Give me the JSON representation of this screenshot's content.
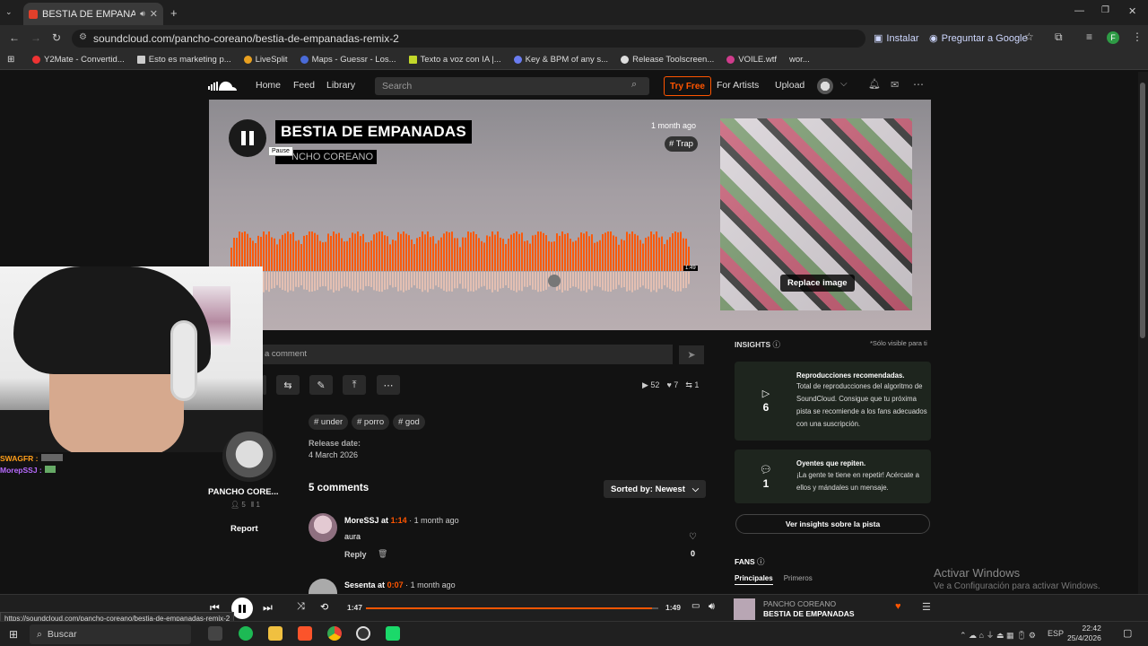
{
  "browser": {
    "tab_title": "BESTIA DE EMPANADAS by",
    "url": "soundcloud.com/pancho-coreano/bestia-de-empanadas-remix-2",
    "install_label": "Instalar",
    "ask_google_label": "Preguntar a Google",
    "bookmarks": [
      "Y2Mate - Convertid...",
      "Esto es marketing p...",
      "LiveSplit",
      "Maps - Guessr - Los...",
      "Texto a voz con IA |...",
      "Key & BPM of any s...",
      "Release Toolscreen...",
      "VOILE.wtf",
      "wor..."
    ],
    "profile_initial": "F"
  },
  "nav": {
    "home": "Home",
    "feed": "Feed",
    "library": "Library",
    "search_placeholder": "Search",
    "try_free": "Try Free",
    "for_artists": "For Artists",
    "upload": "Upload"
  },
  "track": {
    "title": "BESTIA DE EMPANADAS",
    "artist": "PANCHO COREANO",
    "artist_partial": "NCHO COREANO",
    "pause_tooltip": "Pause",
    "posted": "1 month ago",
    "genre_tag": "# Trap",
    "replace_image": "Replace image",
    "duration_mark": "1:49",
    "progress_fraction": 0.02
  },
  "webcam_chat": [
    {
      "user": "SWAGFR :",
      "color": "#ff9f1a",
      "msg": ""
    },
    {
      "user": "MorepSSJ :",
      "color": "#b86bff",
      "msg": ""
    }
  ],
  "actions": {
    "comment_placeholder": "a comment",
    "plays": "52",
    "likes": "7",
    "reposts": "1"
  },
  "tags": [
    "# under",
    "# porro",
    "# god"
  ],
  "release": {
    "label": "Release date:",
    "date": "4 March 2026"
  },
  "uploader": {
    "name": "PANCHO CORE...",
    "followers": "5",
    "tracks": "1",
    "report": "Report"
  },
  "comments": {
    "header": "5 comments",
    "sort": "Sorted by: Newest",
    "items": [
      {
        "user": "MoreSSJ",
        "at": "at",
        "time": "1:14",
        "ago": "· 1 month ago",
        "text": "aura",
        "reply": "Reply",
        "likes": "0"
      },
      {
        "user": "Sesenta",
        "at": "at",
        "time": "0:07",
        "ago": "· 1 month ago"
      }
    ]
  },
  "insights": {
    "title": "INSIGHTS",
    "visibility": "*Sólo visible para ti",
    "card1": {
      "value": "6",
      "title": "Reproducciones recomendadas.",
      "text": "Total de reproducciones del algoritmo de SoundCloud. Consigue que tu próxima pista se recomiende a los fans adecuados con una suscripción."
    },
    "card2": {
      "value": "1",
      "title": "Oyentes que repiten.",
      "text": "¡La gente te tiene en repetir! Acércate a ellos y mándales un mensaje."
    },
    "button": "Ver insights sobre la pista",
    "fans": "FANS",
    "fan_tabs": [
      "Principales",
      "Primeros"
    ]
  },
  "watermark": {
    "line1": "Activar Windows",
    "line2": "Ve a Configuración para activar Windows."
  },
  "player": {
    "current": "1:47",
    "total": "1:49",
    "progress_fraction": 0.98,
    "artist": "PANCHO COREANO",
    "title": "BESTIA DE EMPANADAS"
  },
  "status_url": "https://soundcloud.com/pancho-coreano/bestia-de-empanadas-remix-2",
  "taskbar": {
    "search": "Buscar",
    "lang": "ESP",
    "time": "22:42",
    "date": "25/4/2026"
  },
  "colors": {
    "accent": "#ff5500",
    "waveform_played": "#ff5500"
  }
}
